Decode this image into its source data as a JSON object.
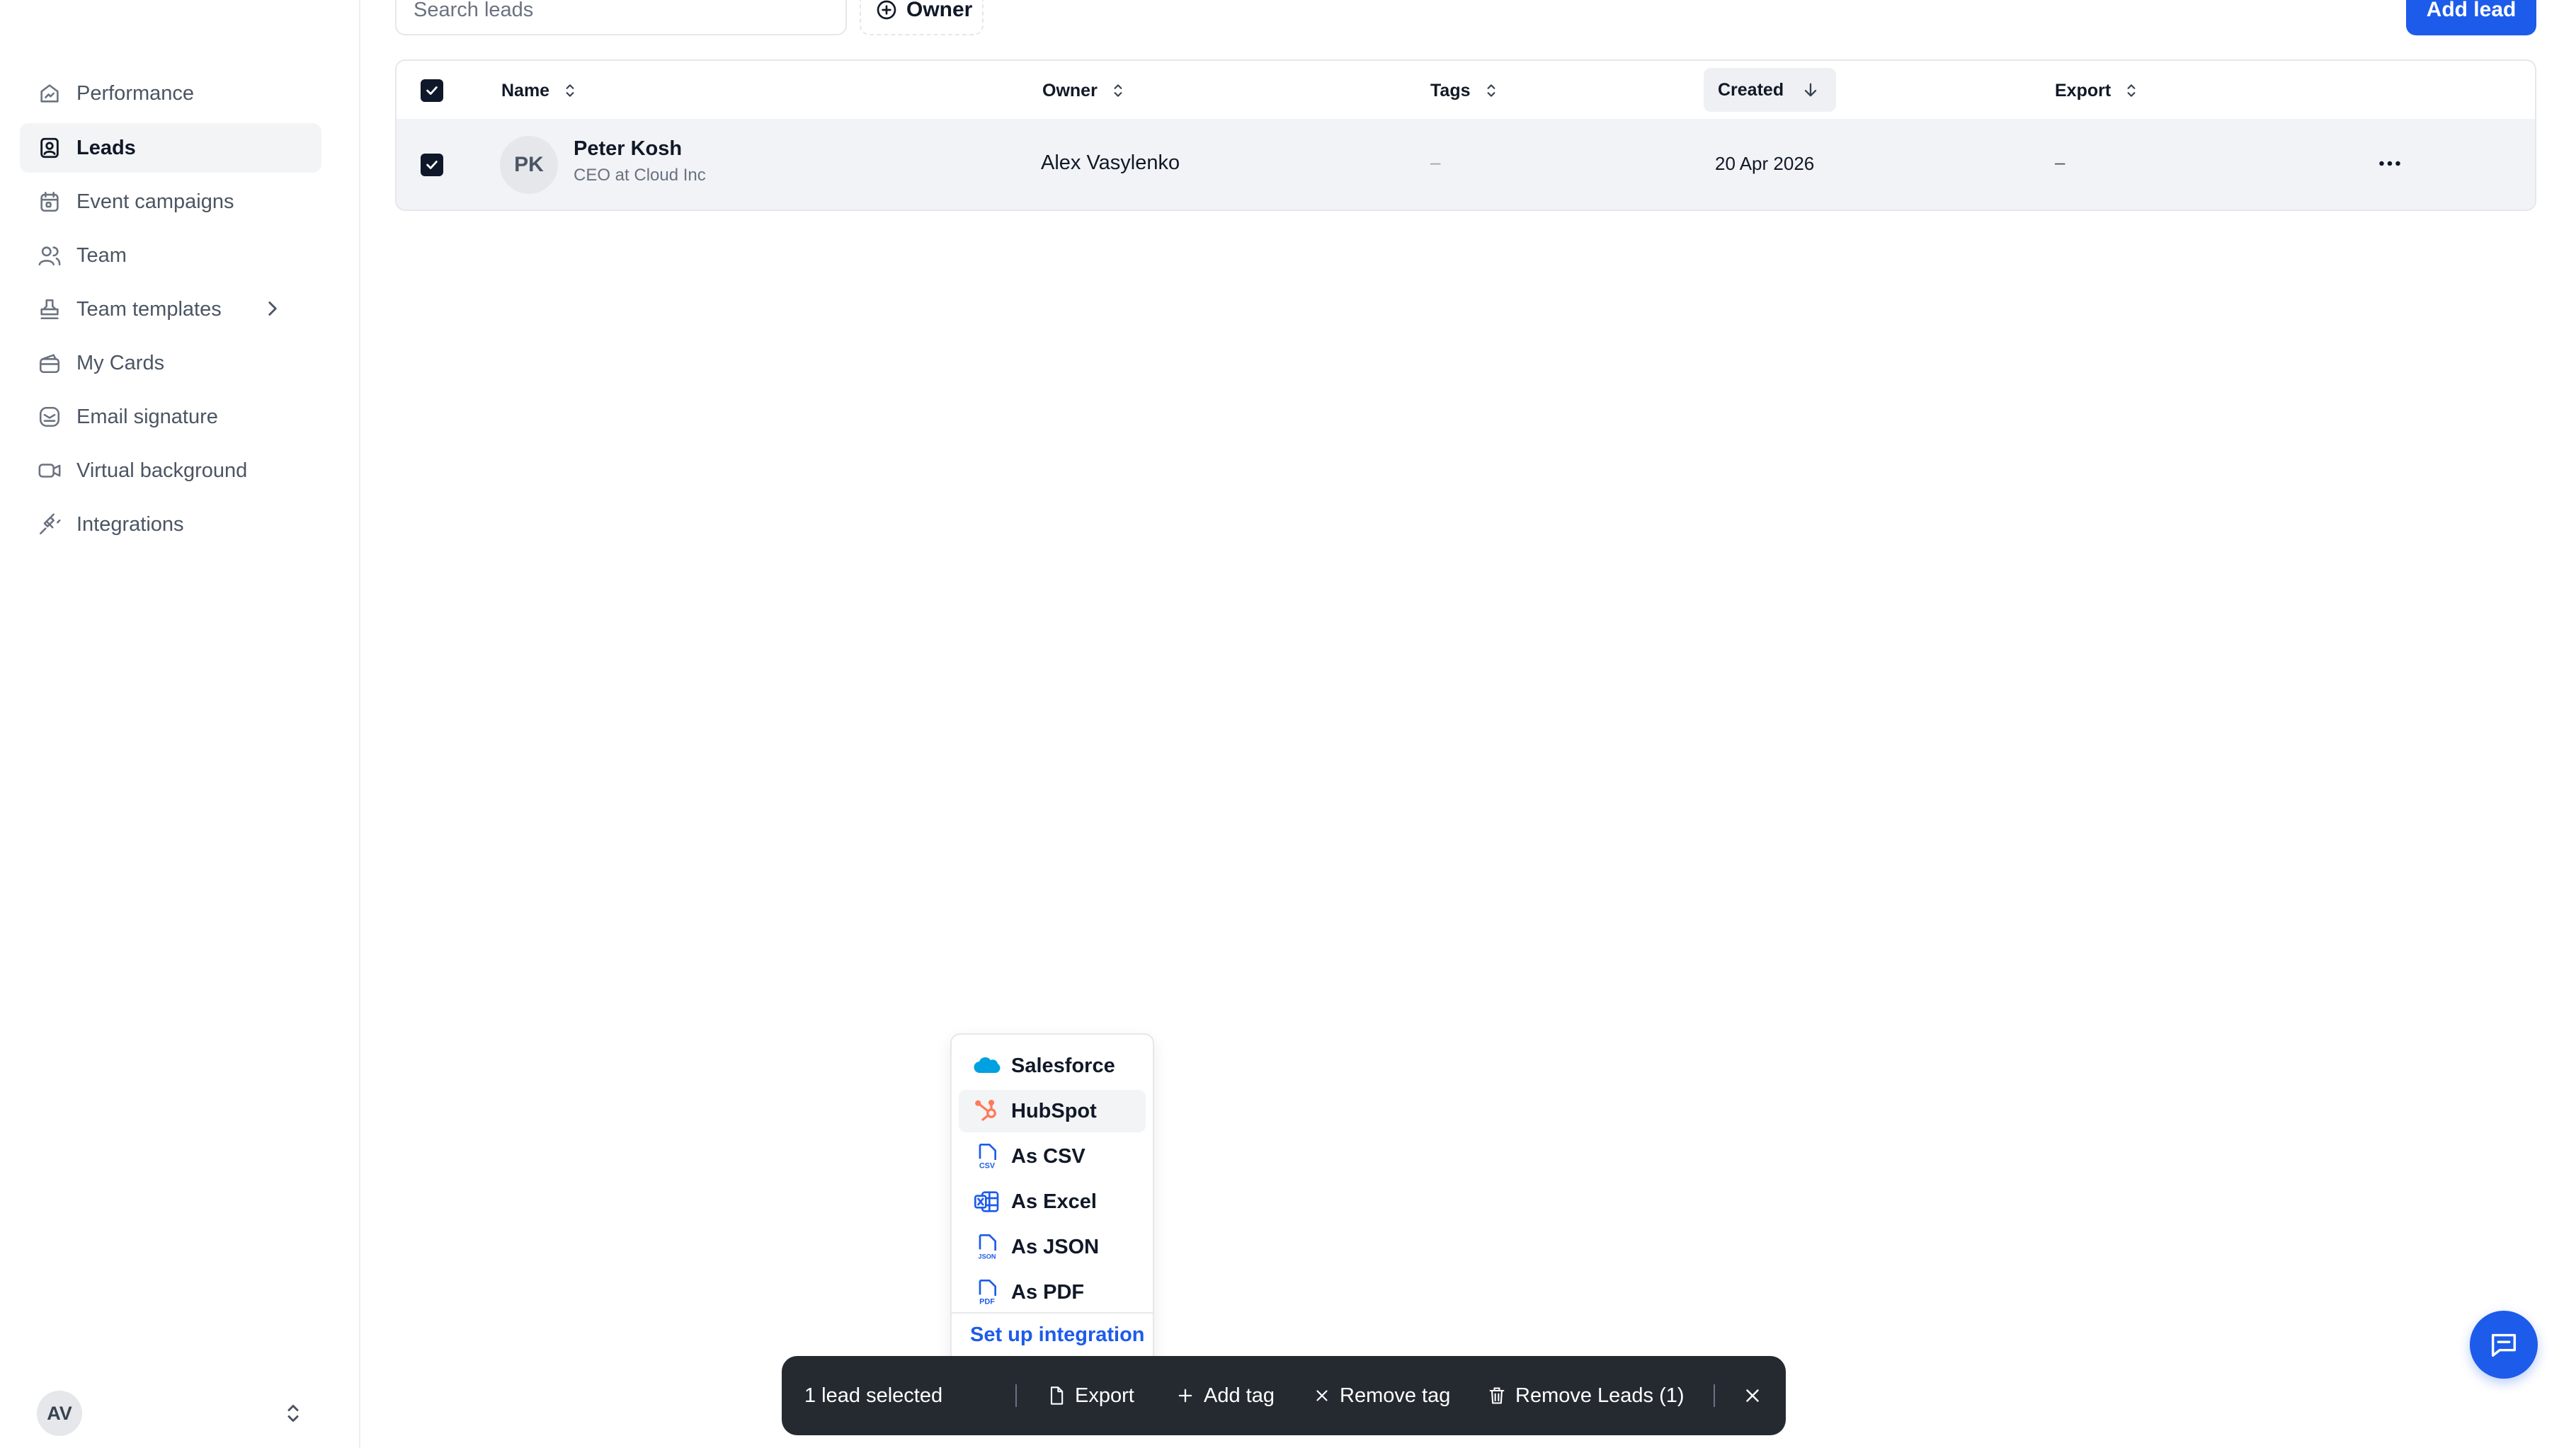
{
  "sidebar": {
    "items": [
      {
        "label": "Performance",
        "icon": "performance-icon"
      },
      {
        "label": "Leads",
        "icon": "leads-icon",
        "active": true
      },
      {
        "label": "Event campaigns",
        "icon": "calendar-icon"
      },
      {
        "label": "Team",
        "icon": "team-icon"
      },
      {
        "label": "Team templates",
        "icon": "stamp-icon"
      },
      {
        "label": "My Cards",
        "icon": "wallet-icon"
      },
      {
        "label": "Email signature",
        "icon": "email-signature-icon"
      },
      {
        "label": "Virtual background",
        "icon": "video-icon"
      },
      {
        "label": "Integrations",
        "icon": "plug-icon"
      }
    ],
    "user_initials": "AV"
  },
  "toolbar": {
    "search_placeholder": "Search leads",
    "owner_filter": "Owner",
    "add_lead": "Add lead"
  },
  "table": {
    "columns": {
      "name": "Name",
      "owner": "Owner",
      "tags": "Tags",
      "created": "Created",
      "export": "Export"
    },
    "rows": [
      {
        "initials": "PK",
        "name": "Peter Kosh",
        "title": "CEO at Cloud Inc",
        "owner": "Alex Vasylenko",
        "tags": "–",
        "created": "20 Apr 2026",
        "export": "–",
        "selected": true
      }
    ]
  },
  "export_menu": {
    "items": [
      {
        "label": "Salesforce",
        "icon": "salesforce-icon"
      },
      {
        "label": "HubSpot",
        "icon": "hubspot-icon"
      },
      {
        "label": "As CSV",
        "icon": "csv-file-icon"
      },
      {
        "label": "As Excel",
        "icon": "excel-file-icon"
      },
      {
        "label": "As JSON",
        "icon": "json-file-icon"
      },
      {
        "label": "As PDF",
        "icon": "pdf-file-icon"
      }
    ],
    "setup_link": "Set up integration",
    "icon_labels": {
      "csv": "CSV",
      "json": "JSON",
      "pdf": "PDF"
    }
  },
  "action_bar": {
    "selected_count": "1 lead selected",
    "export": "Export",
    "add_tag": "Add tag",
    "remove_tag": "Remove tag",
    "remove_leads": "Remove Leads (1)"
  },
  "colors": {
    "accent": "#1d5bea",
    "action_bar_bg": "#252a31",
    "salesforce": "#00a1e0",
    "hubspot": "#ff7a59"
  }
}
